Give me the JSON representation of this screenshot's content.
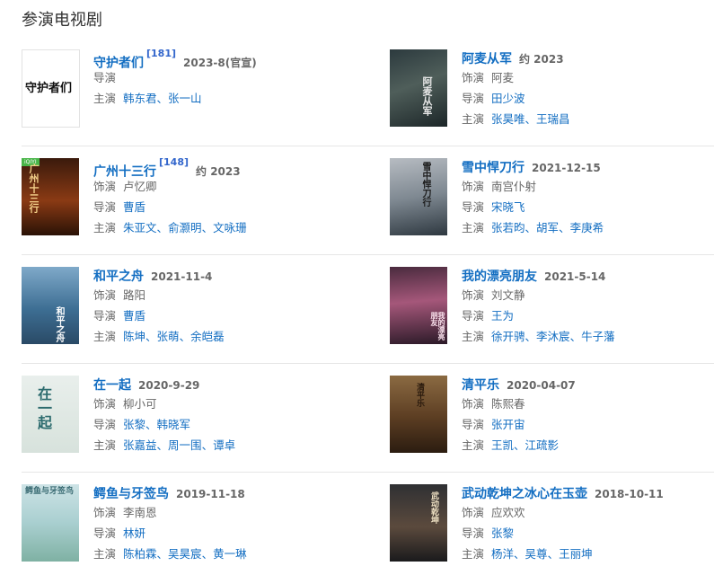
{
  "section_title": "参演电视剧",
  "labels": {
    "role": "饰演",
    "director": "导演",
    "cast": "主演",
    "sep": "、"
  },
  "cards": [
    {
      "title": "守护者们",
      "ref": "[181]",
      "date": "2023-8(官宣)",
      "role": "",
      "director": [],
      "cast": [
        "韩东君",
        "张一山"
      ],
      "poster_text": "守护者们"
    },
    {
      "title": "阿麦从军",
      "ref": "",
      "date": "约 2023",
      "role": "阿麦",
      "director": [
        "田少波"
      ],
      "cast": [
        "张昊唯",
        "王瑞昌"
      ],
      "poster_text": "阿麦从军"
    },
    {
      "title": "广州十三行",
      "ref": "[148]",
      "date": "约 2023",
      "role": "卢忆卿",
      "director": [
        "曹盾"
      ],
      "cast": [
        "朱亚文",
        "俞灏明",
        "文咏珊"
      ],
      "poster_text": "广州十三行",
      "poster_tag": "iQIYI"
    },
    {
      "title": "雪中悍刀行",
      "ref": "",
      "date": "2021-12-15",
      "role": "南宫仆射",
      "director": [
        "宋晓飞"
      ],
      "cast": [
        "张若昀",
        "胡军",
        "李庚希"
      ],
      "poster_text": "雪中悍刀行"
    },
    {
      "title": "和平之舟",
      "ref": "",
      "date": "2021-11-4",
      "role": "路阳",
      "director": [
        "曹盾"
      ],
      "cast": [
        "陈坤",
        "张萌",
        "余皑磊"
      ],
      "poster_text": "和平之舟"
    },
    {
      "title": "我的漂亮朋友",
      "ref": "",
      "date": "2021-5-14",
      "role": "刘文静",
      "director": [
        "王为"
      ],
      "cast": [
        "徐开骋",
        "李沐宸",
        "牛子藩"
      ],
      "poster_text": "我的漂亮朋友"
    },
    {
      "title": "在一起",
      "ref": "",
      "date": "2020-9-29",
      "role": "柳小可",
      "director": [
        "张黎",
        "韩晓军"
      ],
      "cast": [
        "张嘉益",
        "周一围",
        "谭卓"
      ],
      "poster_text": "在一起"
    },
    {
      "title": "清平乐",
      "ref": "",
      "date": "2020-04-07",
      "role": "陈熙春",
      "director": [
        "张开宙"
      ],
      "cast": [
        "王凯",
        "江疏影"
      ],
      "poster_text": "清平乐"
    },
    {
      "title": "鳄鱼与牙签鸟",
      "ref": "",
      "date": "2019-11-18",
      "role": "李南恩",
      "director": [
        "林妍"
      ],
      "cast": [
        "陈柏霖",
        "吴昊宸",
        "黄一琳"
      ],
      "poster_text": "鳄鱼与牙签鸟"
    },
    {
      "title": "武动乾坤之冰心在玉壶",
      "ref": "",
      "date": "2018-10-11",
      "role": "应欢欢",
      "director": [
        "张黎"
      ],
      "cast": [
        "杨洋",
        "吴尊",
        "王丽坤"
      ],
      "poster_text": "武动乾坤"
    }
  ]
}
